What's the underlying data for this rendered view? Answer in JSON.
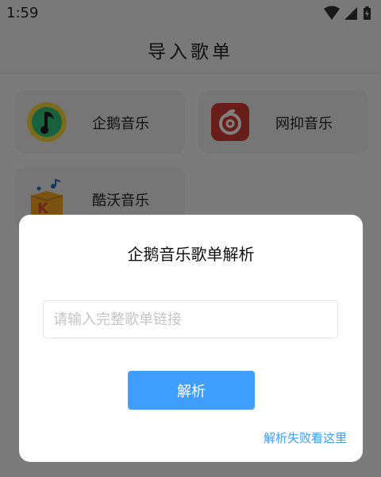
{
  "status_bar": {
    "time": "1:59",
    "icons": [
      "wifi-icon",
      "signal-icon",
      "battery-charging-icon"
    ]
  },
  "header": {
    "title": "导入歌单"
  },
  "sources": [
    {
      "label": "企鹅音乐",
      "icon": "qq-music-logo",
      "color": "#31c27c"
    },
    {
      "label": "网抑音乐",
      "icon": "netease-music-logo",
      "color": "#d43c33"
    },
    {
      "label": "酷沃音乐",
      "icon": "kuwo-music-logo",
      "color": "#f5a623"
    }
  ],
  "dialog": {
    "title": "企鹅音乐歌单解析",
    "input_placeholder": "请输入完整歌单链接",
    "input_value": "",
    "parse_label": "解析",
    "help_link": "解析失败看这里"
  },
  "colors": {
    "accent": "#409eff",
    "overlay": "rgba(0,0,0,0.5)"
  }
}
